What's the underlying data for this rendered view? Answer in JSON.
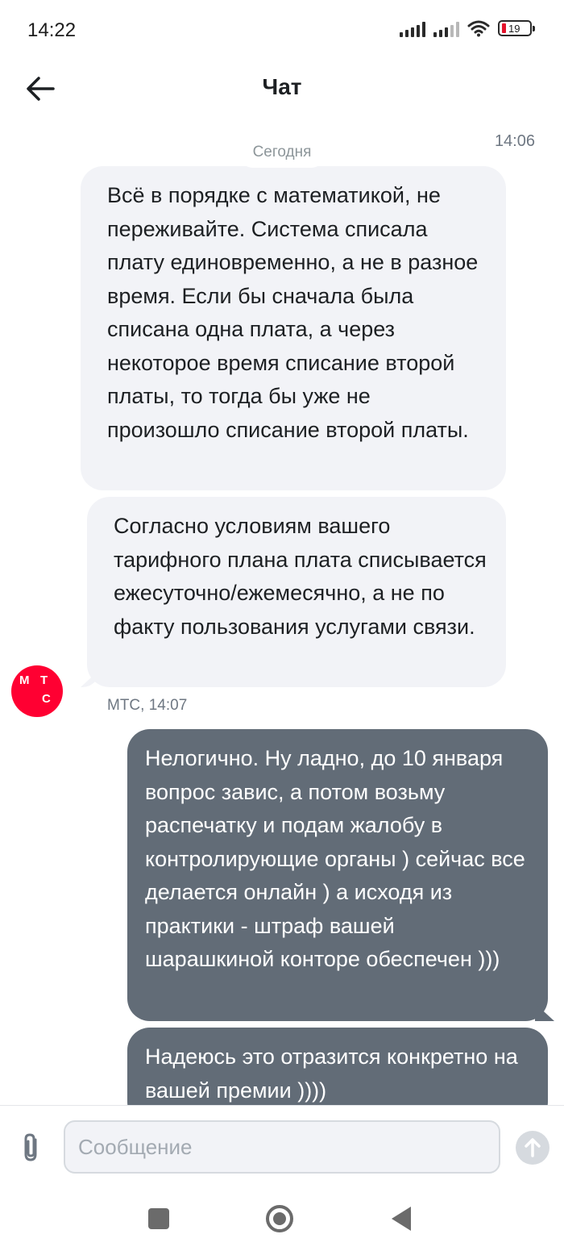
{
  "status_bar": {
    "time": "14:22",
    "battery_level": "19",
    "battery_color": "#e3122b"
  },
  "header": {
    "title": "Чат",
    "back_icon": "arrow-left-icon"
  },
  "chat": {
    "date_separator": "Сегодня",
    "first_time": "14:06",
    "incoming": [
      {
        "text": "Всё в порядке с математикой, не переживайте. Система списала плату единовременно, а не в разное время. Если бы сначала была списана одна плата, а через некоторое время списание второй платы, то тогда бы уже не произошло списание второй платы."
      },
      {
        "text": "Согласно условиям вашего тарифного плана плата списывается ежесуточно/ежемесячно, а не по факту пользования услугами связи."
      }
    ],
    "sender_meta": "МТС, 14:07",
    "avatar": {
      "letters": [
        "М",
        "Т",
        "С"
      ],
      "color": "#ff0032"
    },
    "outgoing": [
      {
        "text": "Нелогично. Ну ладно, до 10 января вопрос завис, а потом возьму распечатку и подам жалобу в контролирующие органы ) сейчас все делается онлайн ) а исходя из практики - штраф вашей шарашкиной конторе обеспечен )))"
      },
      {
        "text": "Надеюсь это отразится конкретно на вашей премии ))))"
      }
    ],
    "outgoing_color": "#626c77",
    "incoming_color": "#f2f3f7"
  },
  "composer": {
    "placeholder": "Сообщение",
    "value": "",
    "attach_icon": "paperclip-icon",
    "send_icon": "arrow-up-icon"
  },
  "nav_bar": {
    "recents_icon": "square-icon",
    "home_icon": "circle-icon",
    "back_icon": "triangle-back-icon"
  }
}
